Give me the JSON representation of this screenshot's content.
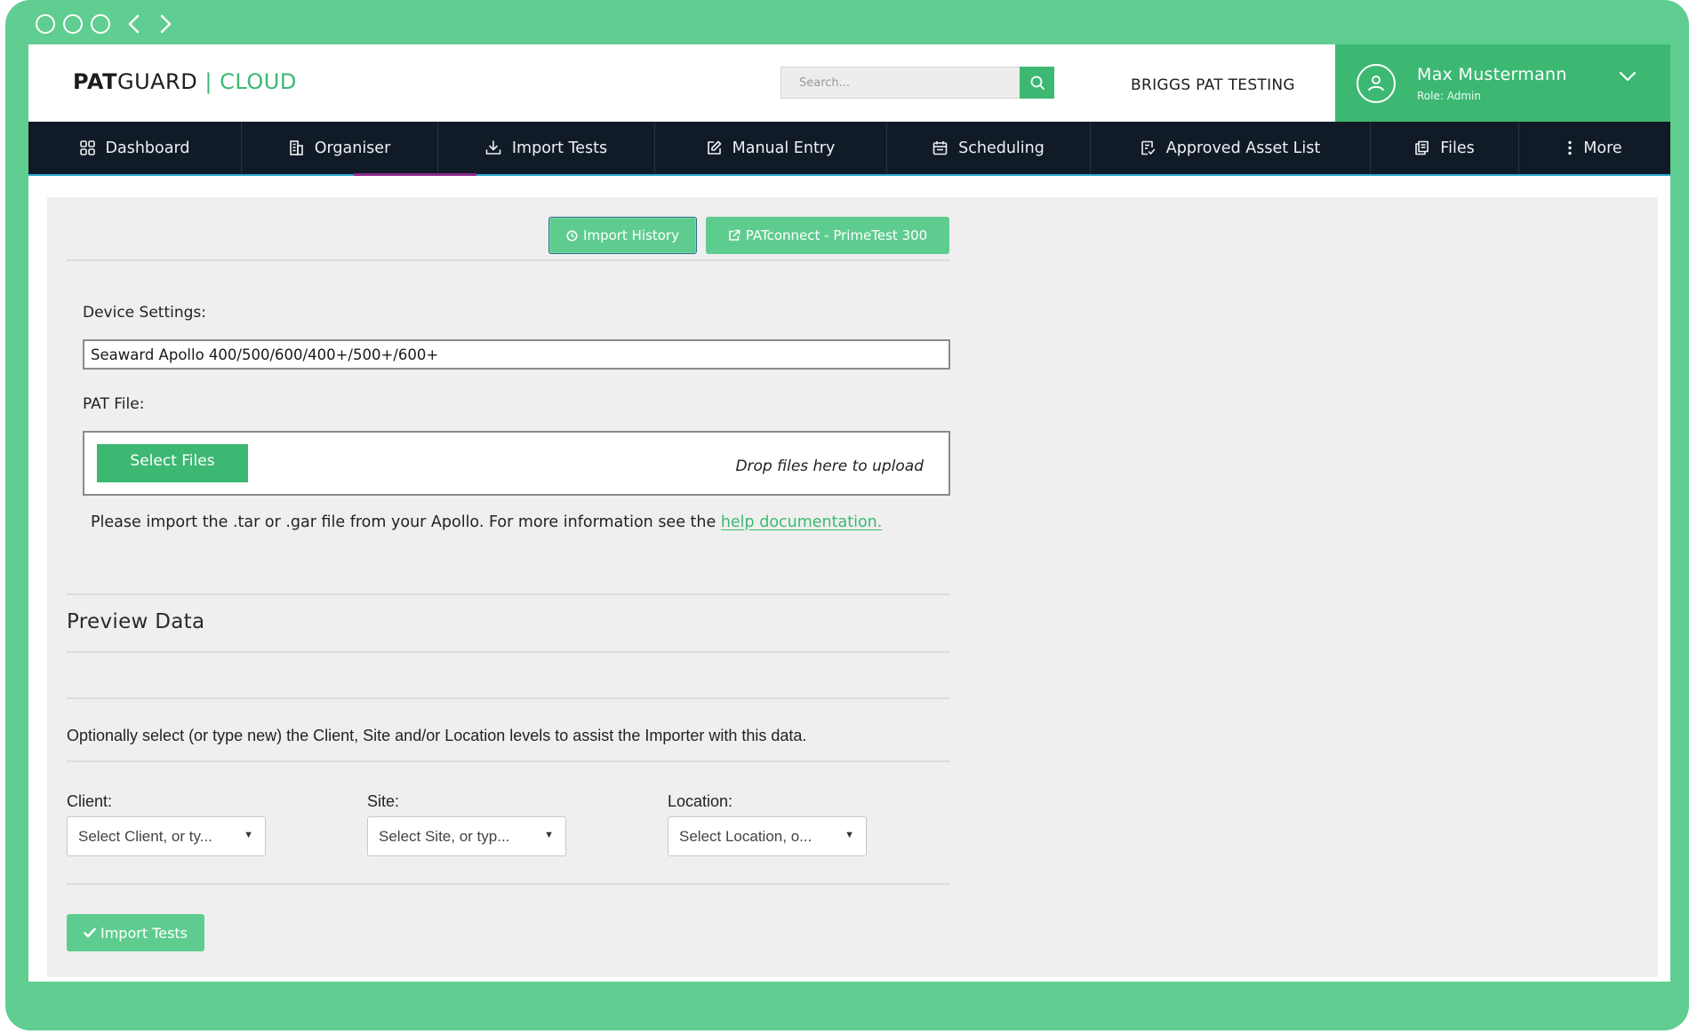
{
  "app": {
    "logo_bold": "PAT",
    "logo_mid": "GUARD",
    "logo_sep": "|",
    "logo_light": "CLOUD"
  },
  "search": {
    "placeholder": "Search..."
  },
  "company_name": "BRIGGS PAT TESTING",
  "user": {
    "name": "Max Mustermann",
    "role": "Role: Admin"
  },
  "nav": {
    "items": [
      {
        "label": "Dashboard",
        "icon": "grid-icon"
      },
      {
        "label": "Organiser",
        "icon": "building-icon"
      },
      {
        "label": "Import Tests",
        "icon": "download-icon"
      },
      {
        "label": "Manual Entry",
        "icon": "edit-icon"
      },
      {
        "label": "Scheduling",
        "icon": "calendar-icon"
      },
      {
        "label": "Approved Asset List",
        "icon": "checklist-icon"
      },
      {
        "label": "Files",
        "icon": "documents-icon"
      },
      {
        "label": "More",
        "icon": "kebab-icon"
      }
    ],
    "active": "Import Tests"
  },
  "buttons": {
    "import_history": "Import History",
    "patconnect": "PATconnect - PrimeTest 300"
  },
  "device_settings": {
    "label": "Device Settings:",
    "value": "Seaward Apollo 400/500/600/400+/500+/600+"
  },
  "pat_file": {
    "label": "PAT File:",
    "select_button": "Select Files",
    "drop_text": "Drop files here to upload"
  },
  "help": {
    "text": "Please import the .tar or .gar file from your Apollo. For more information see the",
    "link": "help documentation."
  },
  "preview": {
    "title": "Preview Data"
  },
  "optional_text": "Optionally select (or type new) the Client, Site and/or Location levels to assist the Importer with this data.",
  "fields": {
    "client": {
      "label": "Client:",
      "placeholder": "Select Client, or ty..."
    },
    "site": {
      "label": "Site:",
      "placeholder": "Select Site, or typ..."
    },
    "location": {
      "label": "Location:",
      "placeholder": "Select Location, o..."
    }
  },
  "import_button": "Import Tests",
  "colors": {
    "frame": "#5fce90",
    "accent": "#3cb872",
    "navbar": "#111b27",
    "content_bg": "#efefef"
  }
}
